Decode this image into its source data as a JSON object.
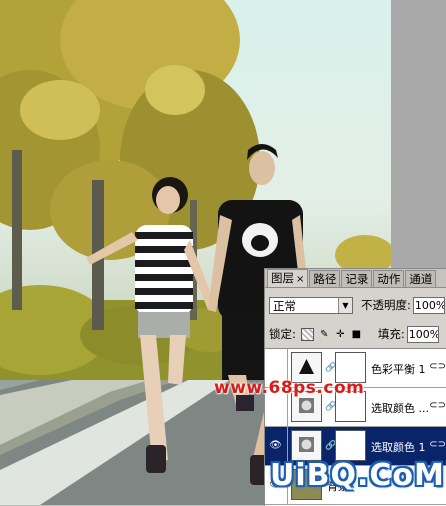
{
  "layers_panel": {
    "tabs": [
      {
        "label": "图层",
        "close": "×"
      },
      {
        "label": "路径"
      },
      {
        "label": "记录"
      },
      {
        "label": "动作"
      },
      {
        "label": "通道"
      }
    ],
    "blend_mode": "正常",
    "opacity_label": "不透明度:",
    "opacity_value": "100%",
    "lock_label": "锁定:",
    "fill_label": "填充:",
    "fill_value": "100%",
    "layers": [
      {
        "name": "色彩平衡 1",
        "icon": "color-balance-icon",
        "selected": false,
        "visible": false
      },
      {
        "name": "选取颜色 ...",
        "icon": "selective-color-icon",
        "selected": false,
        "visible": false
      },
      {
        "name": "选取颜色 1",
        "icon": "selective-color-icon",
        "selected": true,
        "visible": true
      },
      {
        "name": "背景",
        "icon": "photo-thumbnail",
        "selected": false,
        "visible": true
      }
    ]
  },
  "watermarks": {
    "site": "www.68ps.com",
    "brand": "UiBQ.CoM"
  }
}
